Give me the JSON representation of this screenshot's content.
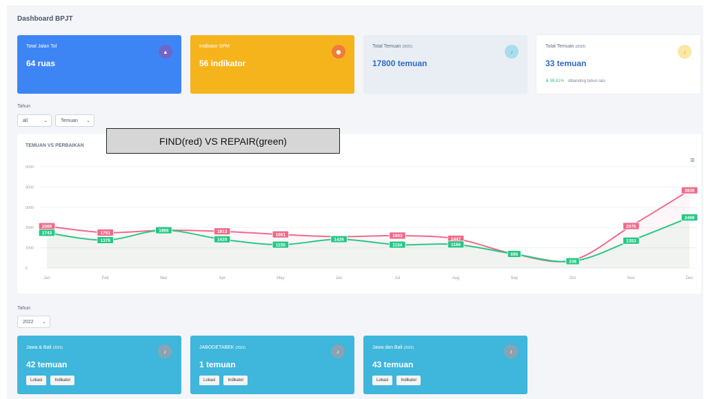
{
  "page_title": "Dashboard BPJT",
  "cards": [
    {
      "label": "Total Jalan Tol",
      "label_small": "",
      "value": "64 ruas",
      "icon": "road-icon"
    },
    {
      "label": "Indikator SPM",
      "label_small": "",
      "value": "56 indikator",
      "icon": "target-icon"
    },
    {
      "label": "Total Temuan",
      "label_small": "(2021)",
      "value": "17800 temuan",
      "icon": "bell-icon"
    },
    {
      "label": "Total Temuan",
      "label_small": "(2022)",
      "value": "33 temuan",
      "icon": "bell-icon",
      "change": "99.81%",
      "change_text": "dibanding tahun lalu"
    }
  ],
  "filters": {
    "tahun_label": "Tahun",
    "year_select": "all",
    "type_select": "Temuan"
  },
  "overlay_text": "FIND(red) VS REPAIR(green)",
  "chart_data": {
    "type": "line",
    "title": "TEMUAN VS PERBAIKAN",
    "categories": [
      "Jan",
      "Feb",
      "Mar",
      "Apr",
      "May",
      "Jun",
      "Jul",
      "Aug",
      "Sep",
      "Oct",
      "Nov",
      "Dec"
    ],
    "ylim": [
      0,
      5000
    ],
    "yticks": [
      "0",
      "1000",
      "2000",
      "3000",
      "4000",
      "5000"
    ],
    "grid": true,
    "series": [
      {
        "color": "#ee6b8a",
        "values": [
          2069,
          1751,
          1866,
          1813,
          1661,
          1550,
          1603,
          1447,
          695,
          390,
          2076,
          3838
        ],
        "labels": [
          "2069",
          "1751",
          "",
          "1813",
          "1661",
          "",
          "1603",
          "1447",
          "",
          "",
          "2076",
          "3838"
        ]
      },
      {
        "color": "#27c785",
        "values": [
          1743,
          1379,
          1866,
          1420,
          1155,
          1426,
          1154,
          1166,
          695,
          338,
          1353,
          2499
        ],
        "labels": [
          "1743",
          "1379",
          "1866",
          "1420",
          "1155",
          "1426",
          "1154",
          "1166",
          "695",
          "338",
          "1353",
          "2499"
        ]
      }
    ]
  },
  "bottom": {
    "tahun_label": "Tahun",
    "year_select": "2022",
    "cards": [
      {
        "label": "Jawa & Bali",
        "label_small": "(2022)",
        "value": "42 temuan",
        "btn1": "Lokasi",
        "btn2": "Indikator"
      },
      {
        "label": "JABODETABEK",
        "label_small": "(2022)",
        "value": "1 temuan",
        "btn1": "Lokasi",
        "btn2": "Indikator"
      },
      {
        "label": "Jawa dan Bali",
        "label_small": "(2022)",
        "value": "43 temuan",
        "btn1": "Lokasi",
        "btn2": "Indikator"
      }
    ]
  }
}
